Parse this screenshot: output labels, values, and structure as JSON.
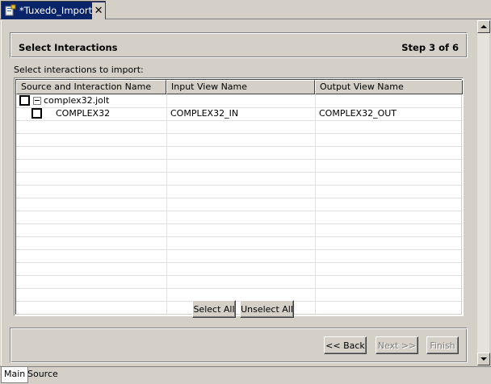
{
  "editor_tab": {
    "title": "*Tuxedo_Import",
    "icon": "import-wizard-icon",
    "close": "✕"
  },
  "header": {
    "title": "Select Interactions",
    "step": "Step 3 of 6"
  },
  "prompt": "Select interactions to import:",
  "table": {
    "columns": [
      "Source and Interaction Name",
      "Input View Name",
      "Output View Name"
    ],
    "rows": [
      {
        "name": "complex32.jolt",
        "input": "",
        "output": "",
        "level": 0,
        "expanded": true,
        "checked": false
      },
      {
        "name": "COMPLEX32",
        "input": "COMPLEX32_IN",
        "output": "COMPLEX32_OUT",
        "level": 1,
        "checked": false
      }
    ]
  },
  "buttons": {
    "select_all": "Select All",
    "unselect_all": "Unselect All",
    "back": "<< Back",
    "next": "Next >>",
    "finish": "Finish"
  },
  "bottom_tabs": [
    "Main",
    "Source"
  ],
  "colors": {
    "tab_active": "#0a246a",
    "window_bg": "#d4d0c8"
  }
}
